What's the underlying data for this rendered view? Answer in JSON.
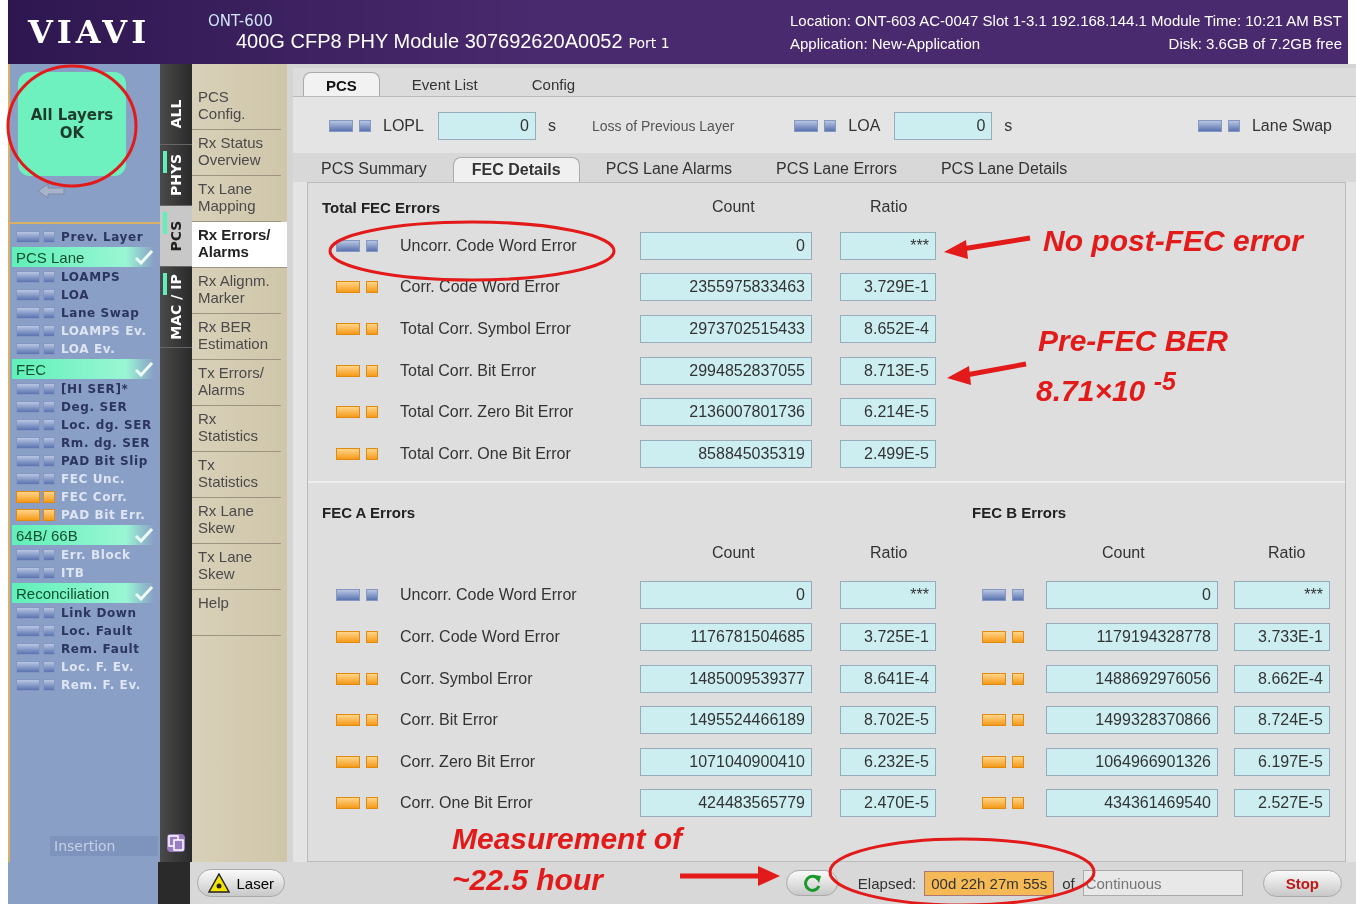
{
  "header": {
    "logo": "VIAVI",
    "product": "ONT-600",
    "module": "400G CFP8 PHY Module 307692620A0052",
    "port": "Port 1",
    "location": "Location: ONT-603 AC-0047 Slot 1-3.1  192.168.144.1 Module Time: 10:21 AM BST",
    "application": "Application: New-Application",
    "disk": "Disk: 3.6GB of 7.2GB free"
  },
  "status_button": {
    "label": "All Layers OK",
    "ok": true
  },
  "signals": [
    {
      "kind": "item",
      "label": "Prev. Layer",
      "event": false,
      "history": false
    },
    {
      "kind": "group",
      "label": "PCS Lane",
      "ok": true
    },
    {
      "kind": "item",
      "label": "LOAMPS",
      "event": false,
      "history": false
    },
    {
      "kind": "item",
      "label": "LOA",
      "event": false,
      "history": false
    },
    {
      "kind": "item",
      "label": "Lane Swap",
      "event": false,
      "history": false
    },
    {
      "kind": "item",
      "label": "LOAMPS Ev.",
      "event": true,
      "history": false
    },
    {
      "kind": "item",
      "label": "LOA Ev.",
      "event": true,
      "history": false
    },
    {
      "kind": "group",
      "label": "FEC",
      "ok": true
    },
    {
      "kind": "item",
      "label": "[HI SER]*",
      "event": false,
      "history": false
    },
    {
      "kind": "item",
      "label": "Deg. SER",
      "event": false,
      "history": false
    },
    {
      "kind": "item",
      "label": "Loc. dg. SER",
      "event": false,
      "history": false
    },
    {
      "kind": "item",
      "label": "Rm. dg. SER",
      "event": false,
      "history": false
    },
    {
      "kind": "item",
      "label": "PAD Bit Slip",
      "event": false,
      "history": false
    },
    {
      "kind": "item",
      "label": "FEC Unc.",
      "event": true,
      "history": false
    },
    {
      "kind": "item",
      "label": "FEC Corr.",
      "event": true,
      "history": true
    },
    {
      "kind": "item",
      "label": "PAD Bit Err.",
      "event": true,
      "history": true
    },
    {
      "kind": "group",
      "label": "64B/ 66B",
      "ok": true
    },
    {
      "kind": "item",
      "label": "Err. Block",
      "event": true,
      "history": false
    },
    {
      "kind": "item",
      "label": "ITB",
      "event": true,
      "history": false
    },
    {
      "kind": "group",
      "label": "Reconciliation",
      "ok": true
    },
    {
      "kind": "item",
      "label": "Link Down",
      "event": false,
      "history": false
    },
    {
      "kind": "item",
      "label": "Loc. Fault",
      "event": false,
      "history": false
    },
    {
      "kind": "item",
      "label": "Rem. Fault",
      "event": false,
      "history": false
    },
    {
      "kind": "item",
      "label": "Loc. F. Ev.",
      "event": true,
      "history": false
    },
    {
      "kind": "item",
      "label": "Rem. F. Ev.",
      "event": true,
      "history": false
    }
  ],
  "insertion": "Insertion",
  "layer_tabs": [
    {
      "label": "ALL",
      "selected": false,
      "ok": false
    },
    {
      "label": "PHYS",
      "selected": false,
      "ok": true
    },
    {
      "label": "PCS",
      "selected": true,
      "ok": true
    },
    {
      "label": "MAC / IP",
      "selected": false,
      "ok": true
    }
  ],
  "menu": [
    {
      "label": "PCS Config.",
      "selected": false
    },
    {
      "label": "Rx Status Overview",
      "selected": false
    },
    {
      "label": "Tx Lane Mapping",
      "selected": false
    },
    {
      "label": "Rx Errors/ Alarms",
      "selected": true
    },
    {
      "label": "Rx Alignm. Marker",
      "selected": false
    },
    {
      "label": "Rx BER Estimation",
      "selected": false
    },
    {
      "label": "Tx Errors/ Alarms",
      "selected": false
    },
    {
      "label": "Rx Statistics",
      "selected": false
    },
    {
      "label": "Tx Statistics",
      "selected": false
    },
    {
      "label": "Rx Lane Skew",
      "selected": false
    },
    {
      "label": "Tx Lane Skew",
      "selected": false
    },
    {
      "label": "Help",
      "selected": false
    }
  ],
  "top_tabs": [
    {
      "label": "PCS",
      "selected": true
    },
    {
      "label": "Event List",
      "selected": false
    },
    {
      "label": "Config",
      "selected": false
    }
  ],
  "indicators": [
    {
      "label": "LOPL",
      "value": "0",
      "unit": "s",
      "description": "Loss of Previous Layer",
      "history": false
    },
    {
      "label": "LOA",
      "value": "0",
      "unit": "s",
      "history": false
    },
    {
      "label": "Lane Swap",
      "history": false
    }
  ],
  "sub_tabs": [
    {
      "label": "PCS Summary",
      "selected": false
    },
    {
      "label": "FEC Details",
      "selected": true
    },
    {
      "label": "PCS Lane Alarms",
      "selected": false
    },
    {
      "label": "PCS Lane Errors",
      "selected": false
    },
    {
      "label": "PCS Lane Details",
      "selected": false
    }
  ],
  "total": {
    "title": "Total FEC Errors",
    "count_header": "Count",
    "ratio_header": "Ratio",
    "rows": [
      {
        "label": "Uncorr. Code Word Error",
        "count": "0",
        "ratio": "***",
        "history": false
      },
      {
        "label": "Corr. Code Word Error",
        "count": "2355975833463",
        "ratio": "3.729E-1",
        "history": true
      },
      {
        "label": "Total Corr. Symbol Error",
        "count": "2973702515433",
        "ratio": "8.652E-4",
        "history": true
      },
      {
        "label": "Total Corr. Bit Error",
        "count": "2994852837055",
        "ratio": "8.713E-5",
        "history": true
      },
      {
        "label": "Total Corr. Zero Bit Error",
        "count": "2136007801736",
        "ratio": "6.214E-5",
        "history": true
      },
      {
        "label": "Total Corr. One Bit Error",
        "count": "858845035319",
        "ratio": "2.499E-5",
        "history": true
      }
    ]
  },
  "fec_ab": {
    "a_title": "FEC A Errors",
    "b_title": "FEC B Errors",
    "a_count_header": "Count",
    "a_ratio_header": "Ratio",
    "b_count_header": "Count",
    "b_ratio_header": "Ratio",
    "rows": [
      {
        "label": "Uncorr. Code Word Error",
        "a_count": "0",
        "a_ratio": "***",
        "a_history": false,
        "b_count": "0",
        "b_ratio": "***",
        "b_history": false
      },
      {
        "label": "Corr. Code Word Error",
        "a_count": "1176781504685",
        "a_ratio": "3.725E-1",
        "a_history": true,
        "b_count": "1179194328778",
        "b_ratio": "3.733E-1",
        "b_history": true
      },
      {
        "label": "Corr. Symbol Error",
        "a_count": "1485009539377",
        "a_ratio": "8.641E-4",
        "a_history": true,
        "b_count": "1488692976056",
        "b_ratio": "8.662E-4",
        "b_history": true
      },
      {
        "label": "Corr. Bit Error",
        "a_count": "1495524466189",
        "a_ratio": "8.702E-5",
        "a_history": true,
        "b_count": "1499328370866",
        "b_ratio": "8.724E-5",
        "b_history": true
      },
      {
        "label": "Corr. Zero Bit Error",
        "a_count": "1071040900410",
        "a_ratio": "6.232E-5",
        "a_history": true,
        "b_count": "1064966901326",
        "b_ratio": "6.197E-5",
        "b_history": true
      },
      {
        "label": "Corr. One Bit Error",
        "a_count": "424483565779",
        "a_ratio": "2.470E-5",
        "a_history": true,
        "b_count": "434361469540",
        "b_ratio": "2.527E-5",
        "b_history": true
      }
    ]
  },
  "bottom": {
    "laser": "Laser",
    "elapsed_label": "Elapsed:",
    "elapsed": "00d 22h 27m 55s",
    "of": "of",
    "duration_placeholder": "Continuous",
    "stop": "Stop"
  },
  "annotations": [
    {
      "kind": "callout",
      "text": "No post-FEC error"
    },
    {
      "kind": "callout",
      "text": "Pre-FEC BER"
    },
    {
      "kind": "callout",
      "text": "8.71×10 $^{-5}$"
    },
    {
      "kind": "callout",
      "text": "Measurement of"
    },
    {
      "kind": "callout",
      "text": "~22.5 hour"
    }
  ]
}
